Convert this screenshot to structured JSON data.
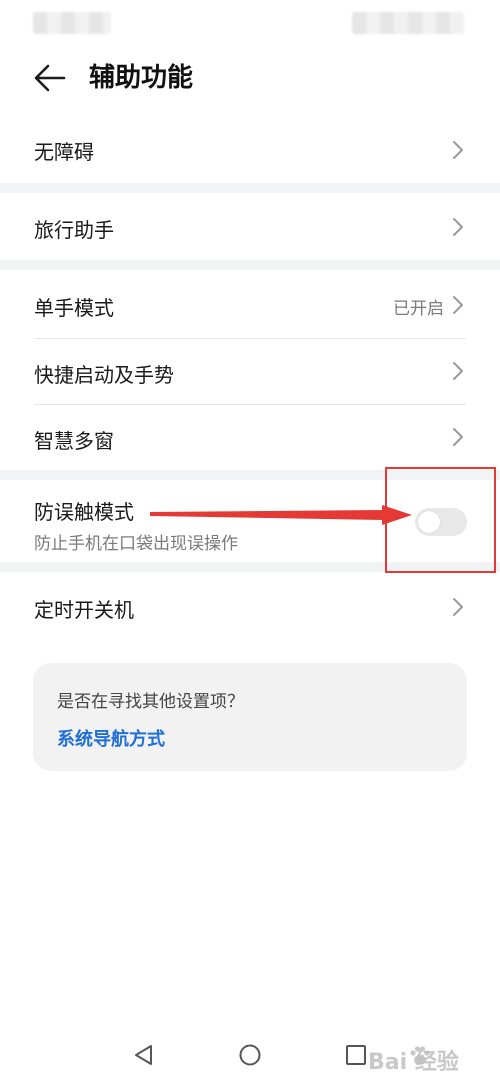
{
  "header": {
    "title": "辅助功能"
  },
  "sections": [
    [
      {
        "label": "无障碍"
      }
    ],
    [
      {
        "label": "旅行助手"
      }
    ],
    [
      {
        "label": "单手模式",
        "value": "已开启"
      },
      {
        "label": "快捷启动及手势"
      },
      {
        "label": "智慧多窗"
      }
    ],
    [
      {
        "label": "防误触模式",
        "sublabel": "防止手机在口袋出现误操作",
        "toggle_on": false
      }
    ],
    [
      {
        "label": "定时开关机"
      }
    ]
  ],
  "suggestion": {
    "question": "是否在寻找其他设置项？",
    "link": "系统导航方式"
  },
  "watermark": {
    "text": "Bai  经验"
  },
  "colors": {
    "accent_link": "#1f6fd6",
    "annotation_red": "#e53935",
    "section_gap": "#f1f3f5"
  },
  "icons": {
    "back": "arrow-left-icon",
    "chevron": "chevron-right-icon",
    "nav_back": "triangle-back-icon",
    "nav_home": "circle-home-icon",
    "nav_recent": "square-recent-icon"
  }
}
